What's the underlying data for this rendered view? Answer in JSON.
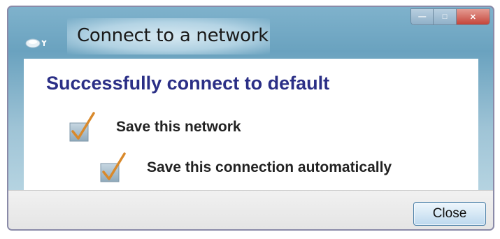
{
  "window": {
    "title": "Connect to a network"
  },
  "dialog": {
    "heading": "Successfully connect to default",
    "options": [
      {
        "label": "Save this network",
        "checked": true
      },
      {
        "label": "Save this connection automatically",
        "checked": true
      }
    ]
  },
  "footer": {
    "close_label": "Close"
  },
  "icons": {
    "network": "network-icon",
    "checkbox": "checkbox-checked-icon"
  },
  "colors": {
    "heading": "#2b2f86",
    "titlebar": "#7fb2cc",
    "checkmark": "#d9892b"
  }
}
